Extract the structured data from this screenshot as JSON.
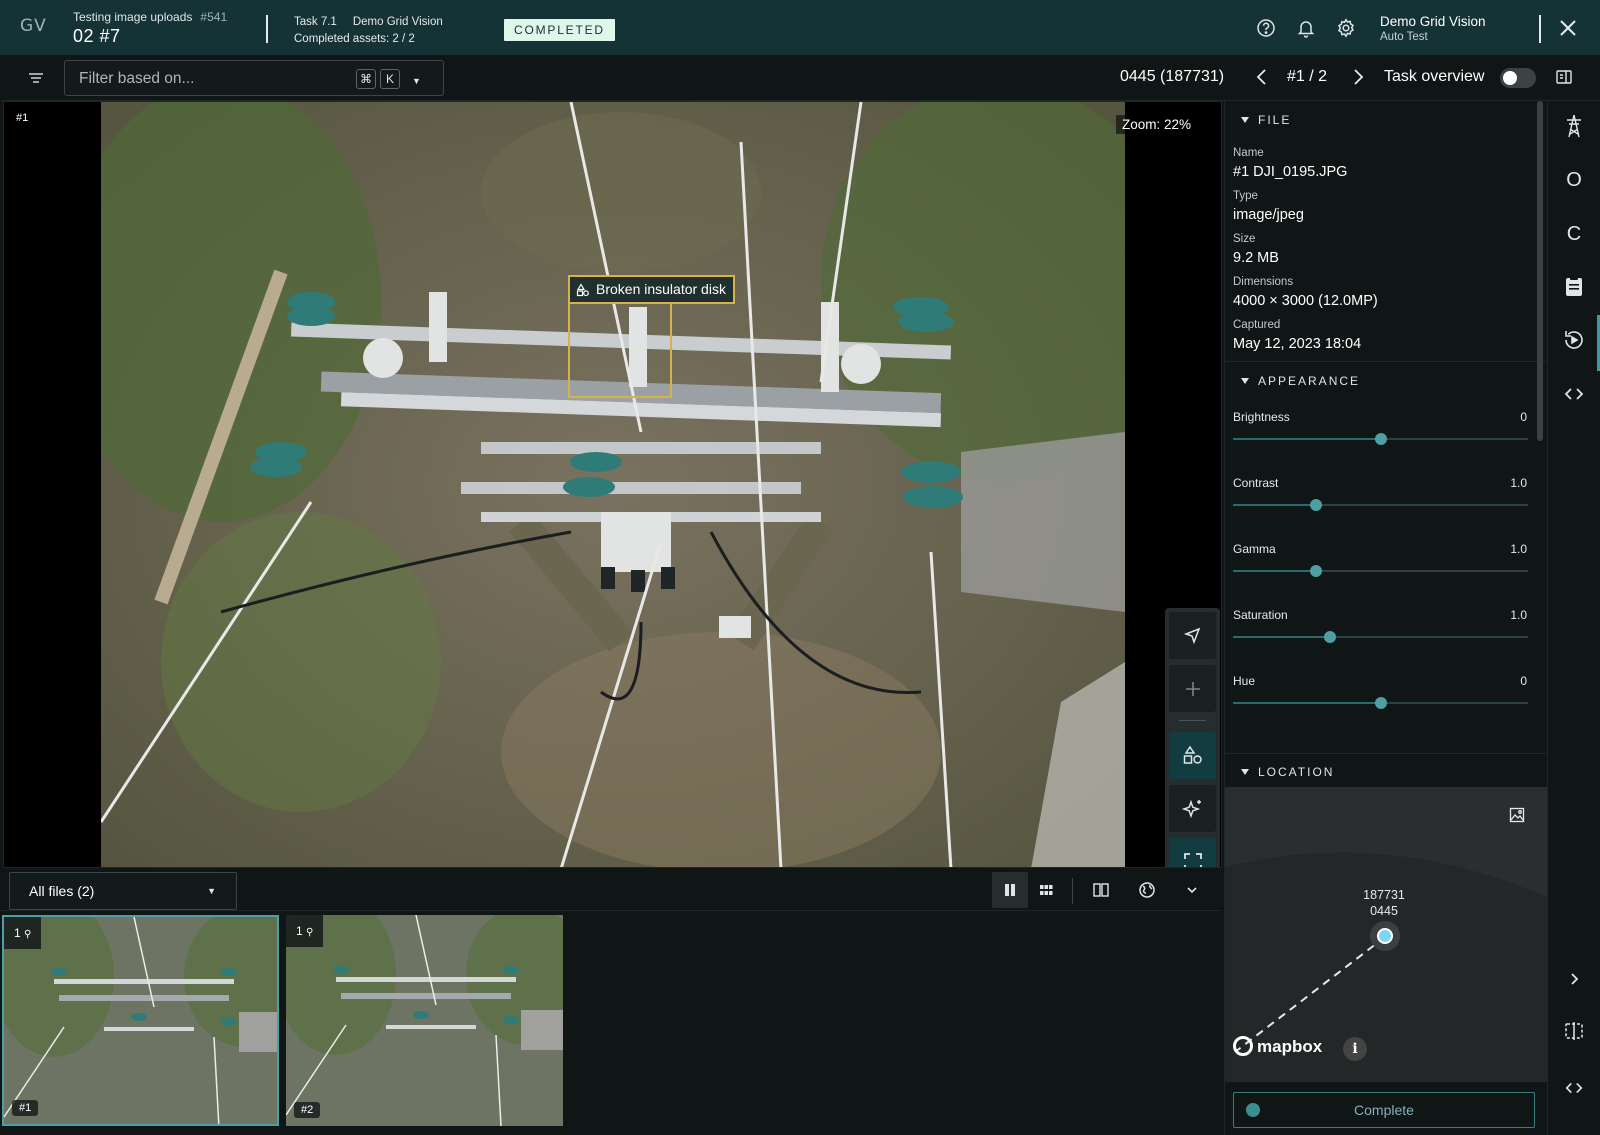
{
  "header": {
    "logo": "GV",
    "project_name": "Testing image uploads",
    "project_number": "#541",
    "project_sub": "02  #7",
    "task_id": "Task 7.1",
    "task_org": "Demo Grid Vision",
    "task_progress": "Completed assets: 2 / 2",
    "status": "COMPLETED",
    "user_name": "Demo Grid Vision",
    "user_role": "Auto Test"
  },
  "filter": {
    "placeholder": "Filter based on...",
    "kbd_cmd": "⌘",
    "kbd_key": "K"
  },
  "navigation": {
    "asset_id": "0445 (187731)",
    "position": "#1 / 2",
    "task_overview_label": "Task overview",
    "task_overview_on": false
  },
  "viewer": {
    "image_label": "#1",
    "zoom": "Zoom: 22%",
    "annotation_label": "Broken insulator disk",
    "annotation_color": "#d7b24a"
  },
  "bottom": {
    "files_select": "All files (2)",
    "thumbnails": [
      {
        "count": "1",
        "label": "#1",
        "selected": true
      },
      {
        "count": "1",
        "label": "#2",
        "selected": false
      }
    ]
  },
  "file_section": {
    "heading": "FILE",
    "name_label": "Name",
    "name_value": "#1 DJI_0195.JPG",
    "type_label": "Type",
    "type_value": "image/jpeg",
    "size_label": "Size",
    "size_value": "9.2 MB",
    "dims_label": "Dimensions",
    "dims_value": "4000 × 3000 (12.0MP)",
    "captured_label": "Captured",
    "captured_value": "May 12, 2023 18:04"
  },
  "appearance": {
    "heading": "APPEARANCE",
    "sliders": [
      {
        "label": "Brightness",
        "value": "0",
        "level": 0.5
      },
      {
        "label": "Contrast",
        "value": "1.0",
        "level": 0.28
      },
      {
        "label": "Gamma",
        "value": "1.0",
        "level": 0.28
      },
      {
        "label": "Saturation",
        "value": "1.0",
        "level": 0.33
      },
      {
        "label": "Hue",
        "value": "0",
        "level": 0.5
      }
    ]
  },
  "location": {
    "heading": "LOCATION",
    "marker_line1": "187731",
    "marker_line2": "0445",
    "attribution": "mapbox",
    "info": "i"
  },
  "actions": {
    "complete_label": "Complete"
  },
  "rail": {
    "icon_o": "O",
    "icon_c": "C"
  },
  "colors": {
    "topbar": "#153236",
    "accent": "#3e9aa0",
    "status_badge_bg": "#dff6ea"
  }
}
